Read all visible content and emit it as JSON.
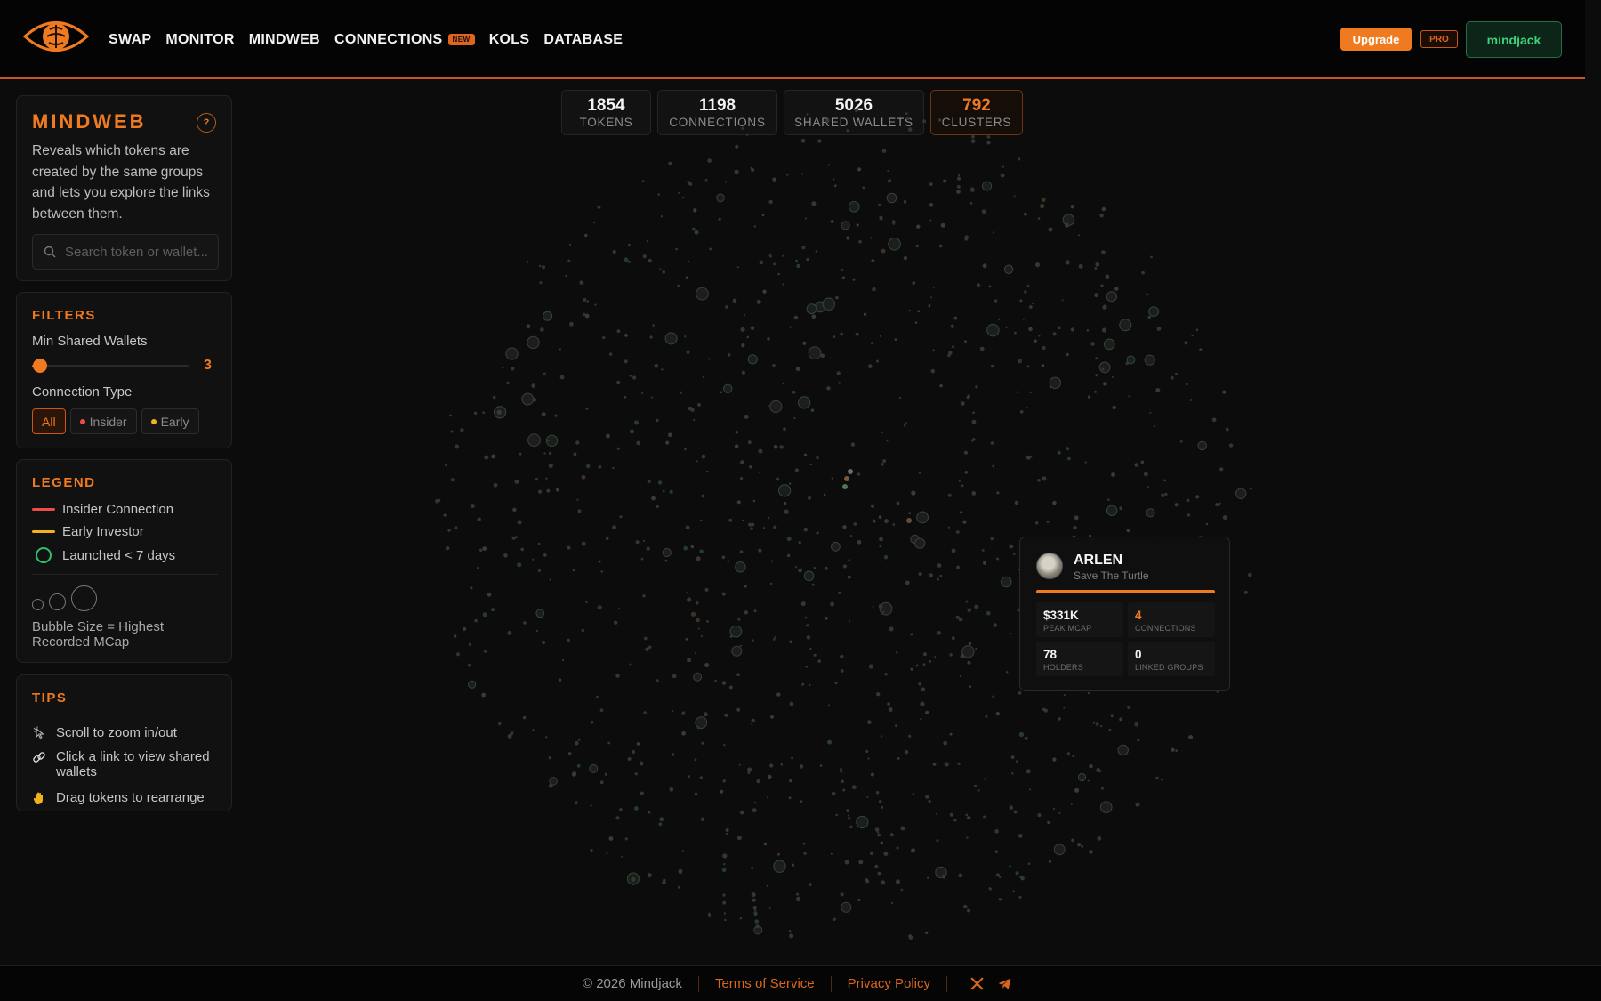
{
  "nav": {
    "items": [
      {
        "label": "SWAP"
      },
      {
        "label": "MONITOR"
      },
      {
        "label": "MINDWEB"
      },
      {
        "label": "CONNECTIONS",
        "badge": "NEW"
      },
      {
        "label": "KOLS"
      },
      {
        "label": "DATABASE"
      }
    ],
    "upgrade_label": "Upgrade",
    "pro_label": "PRO",
    "user_label": "mindjack"
  },
  "stats": [
    {
      "value": "1854",
      "label": "TOKENS"
    },
    {
      "value": "1198",
      "label": "CONNECTIONS"
    },
    {
      "value": "5026",
      "label": "SHARED WALLETS"
    },
    {
      "value": "792",
      "label": "CLUSTERS"
    }
  ],
  "mindweb": {
    "title": "MINDWEB",
    "help": "?",
    "description": "Reveals which tokens are created by the same groups and lets you explore the links between them.",
    "search_placeholder": "Search token or wallet..."
  },
  "filters": {
    "title": "FILTERS",
    "min_shared_label": "Min Shared Wallets",
    "min_shared_value": "3",
    "slider_fraction": 0.05,
    "connection_type_label": "Connection Type",
    "types": [
      {
        "label": "All",
        "active": true
      },
      {
        "label": "Insider",
        "dot": "#ef4b4b"
      },
      {
        "label": "Early",
        "dot": "#f2b21c"
      }
    ]
  },
  "legend": {
    "title": "LEGEND",
    "insider": "Insider Connection",
    "early": "Early Investor",
    "launched": "Launched < 7 days",
    "bubble_size": "Bubble Size = Highest Recorded MCap"
  },
  "tips": {
    "title": "TIPS",
    "items": [
      {
        "icon": "mouse-icon",
        "text": "Scroll to zoom in/out"
      },
      {
        "icon": "link-icon",
        "text": "Click a link to view shared wallets"
      },
      {
        "icon": "hand-icon",
        "text": "Drag tokens to rearrange"
      }
    ]
  },
  "token_card": {
    "name": "ARLEN",
    "subtitle": "Save The Turtle",
    "peak_mcap_value": "$331K",
    "peak_mcap_label": "PEAK MCAP",
    "connections_value": "4",
    "connections_label": "CONNECTIONS",
    "holders_value": "78",
    "holders_label": "HOLDERS",
    "linked_value": "0",
    "linked_label": "LINKED GROUPS"
  },
  "footer": {
    "copyright": "© 2026 Mindjack",
    "terms": "Terms of Service",
    "privacy": "Privacy Policy"
  },
  "colors": {
    "accent": "#f07a20",
    "insider": "#ef4b4b",
    "early": "#f2b21c",
    "new_launch": "#2fbf6a",
    "user_green": "#3fd07a"
  }
}
